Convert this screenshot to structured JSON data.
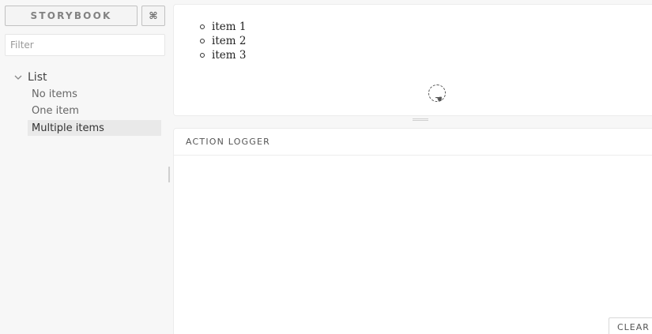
{
  "sidebar": {
    "brand_label": "STORYBOOK",
    "shortcut_label": "⌘",
    "filter_placeholder": "Filter",
    "kind": {
      "label": "List",
      "expanded": true,
      "stories": [
        {
          "label": "No items",
          "selected": false
        },
        {
          "label": "One item",
          "selected": false
        },
        {
          "label": "Multiple items",
          "selected": true
        }
      ]
    }
  },
  "preview": {
    "list_items": [
      "item 1",
      "item 2",
      "item 3"
    ]
  },
  "addons": {
    "panel_title": "ACTION LOGGER",
    "clear_label": "CLEAR"
  },
  "colors": {
    "background": "#f7f7f7",
    "panel": "#ffffff",
    "selected_story": "#e9e9e9",
    "border": "#ececec"
  }
}
